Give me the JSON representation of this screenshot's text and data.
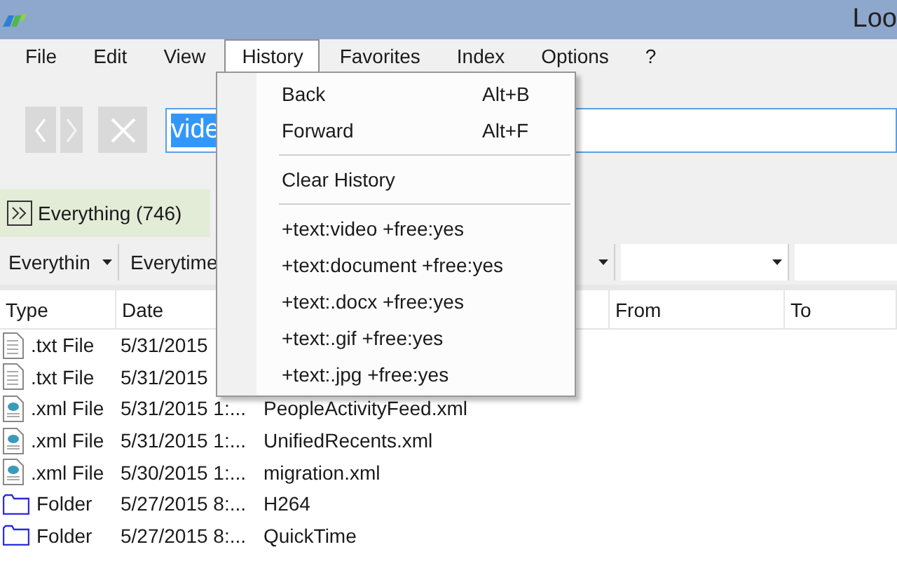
{
  "title_bar": {
    "title": "Loo"
  },
  "menu_bar": [
    {
      "label": "File",
      "selected": false
    },
    {
      "label": "Edit",
      "selected": false
    },
    {
      "label": "View",
      "selected": false
    },
    {
      "label": "History",
      "selected": true
    },
    {
      "label": "Favorites",
      "selected": false
    },
    {
      "label": "Index",
      "selected": false
    },
    {
      "label": "Options",
      "selected": false
    },
    {
      "label": "?",
      "selected": false
    }
  ],
  "toolbar": {
    "search": {
      "value": "vide",
      "highlighted": true
    }
  },
  "tabs": [
    {
      "label": "Everything (746)",
      "selected": true
    }
  ],
  "filters": [
    {
      "kind": "dropdown",
      "value": "Everythin"
    },
    {
      "kind": "dropdown",
      "value": "Everytime"
    },
    {
      "kind": "dropdown"
    },
    {
      "kind": "field"
    }
  ],
  "table": {
    "columns": [
      "Type",
      "Date",
      "From",
      "To"
    ],
    "rows": [
      {
        "kind": "text",
        "type": ".txt File",
        "date": "5/31/2015"
      },
      {
        "kind": "text",
        "type": ".txt File",
        "date": "5/31/2015"
      },
      {
        "kind": "xml",
        "type": ".xml File",
        "date": "5/31/2015 1:...",
        "name": "PeopleActivityFeed.xml"
      },
      {
        "kind": "xml",
        "type": ".xml File",
        "date": "5/31/2015 1:...",
        "name": "UnifiedRecents.xml"
      },
      {
        "kind": "xml",
        "type": ".xml File",
        "date": "5/30/2015 1:...",
        "name": "migration.xml"
      },
      {
        "kind": "folder",
        "type": "Folder",
        "date": "5/27/2015 8:...",
        "name": "H264"
      },
      {
        "kind": "folder",
        "type": "Folder",
        "date": "5/27/2015 8:...",
        "name": "QuickTime"
      }
    ]
  },
  "history_menu": [
    {
      "kind": "item",
      "label": "Back",
      "shortcut": "Alt+B"
    },
    {
      "kind": "item",
      "label": "Forward",
      "shortcut": "Alt+F"
    },
    {
      "kind": "separator"
    },
    {
      "kind": "item",
      "label": "Clear History"
    },
    {
      "kind": "separator"
    },
    {
      "kind": "item",
      "label": "+text:video +free:yes"
    },
    {
      "kind": "item",
      "label": "+text:document +free:yes"
    },
    {
      "kind": "item",
      "label": "+text:.docx +free:yes"
    },
    {
      "kind": "item",
      "label": "+text:.gif +free:yes"
    },
    {
      "kind": "item",
      "label": "+text:.jpg +free:yes"
    }
  ]
}
